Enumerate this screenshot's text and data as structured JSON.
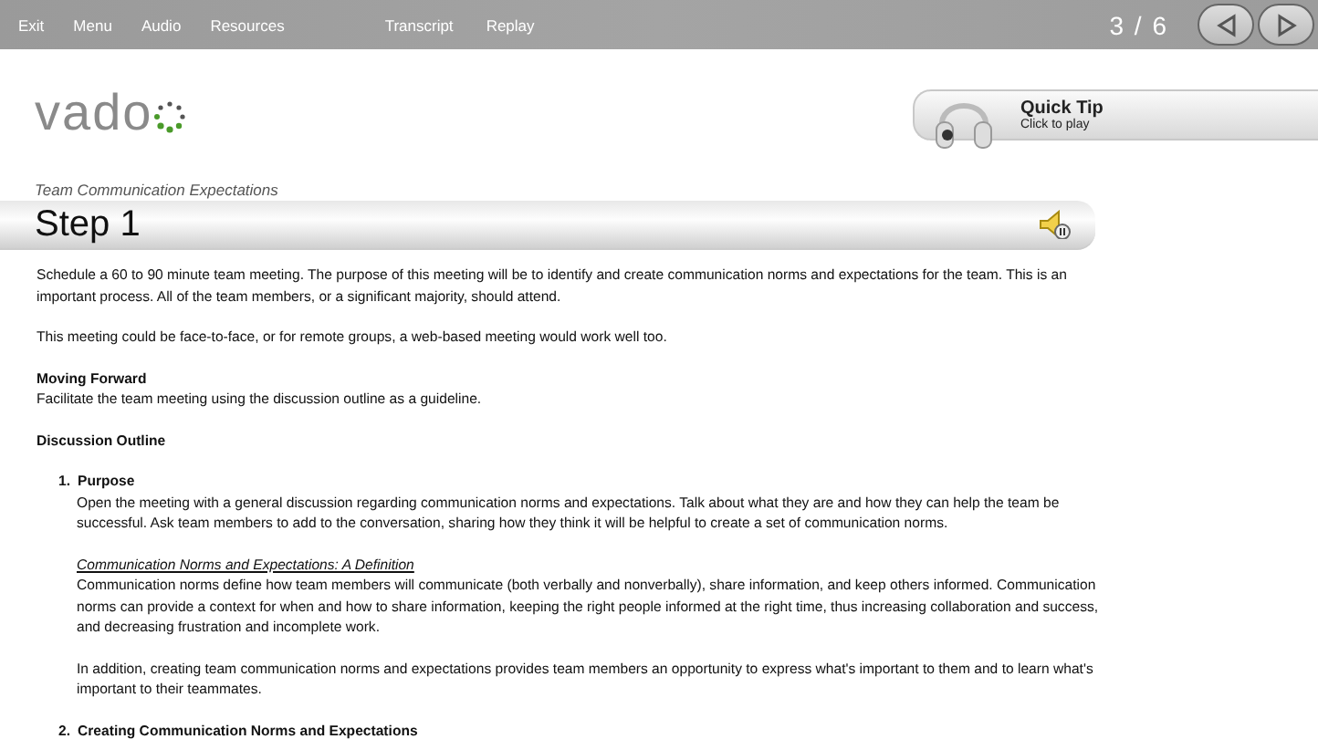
{
  "top_bar": {
    "menu_left": [
      "Exit",
      "Menu",
      "Audio",
      "Resources"
    ],
    "menu_center": [
      "Transcript",
      "Replay"
    ],
    "page_counter": "3 / 6"
  },
  "logo": {
    "text": "vado"
  },
  "quick_tip": {
    "title": "Quick Tip",
    "subtitle": "Click to play"
  },
  "section_title": "Team Communication Expectations",
  "step_title": "Step 1",
  "content": [
    {
      "kind": "paragraph",
      "text": "Schedule a 60 to 90 minute team meeting. The purpose of this meeting will be to identify and create communication norms and expectations for the team. This is an important process. All of the team members, or a significant majority, should attend."
    },
    {
      "kind": "paragraph",
      "text": "This meeting could be face-to-face, or for remote groups, a web-based meeting would work well too."
    },
    {
      "kind": "heading",
      "text": "Moving Forward"
    },
    {
      "kind": "line",
      "text": "Facilitate the team meeting using the discussion outline as a guideline."
    },
    {
      "kind": "heading",
      "text": "Discussion Outline"
    }
  ],
  "outline": [
    {
      "number": "1.",
      "title": "Purpose",
      "blocks": [
        {
          "kind": "paragraph",
          "text": "Open the meeting with a general discussion regarding communication norms and expectations. Talk about what they are and how they can help the team be successful. Ask team members to add to the conversation, sharing how they think it will be helpful to create a set of communication norms."
        },
        {
          "kind": "subheading",
          "text": "Communication Norms and Expectations: A Definition"
        },
        {
          "kind": "paragraph",
          "text": "Communication norms define how team members will communicate (both verbally and nonverbally), share information, and keep others informed. Communication norms can provide a context for when and how to share information, keeping the right people informed at the right time, thus increasing collaboration and success, and decreasing frustration and incomplete work."
        },
        {
          "kind": "paragraph",
          "text": "In addition, creating team communication norms and expectations provides team members an opportunity to express what's important to them and to learn what's important to their teammates."
        }
      ]
    },
    {
      "number": "2.",
      "title": "Creating Communication Norms and Expectations"
    }
  ]
}
